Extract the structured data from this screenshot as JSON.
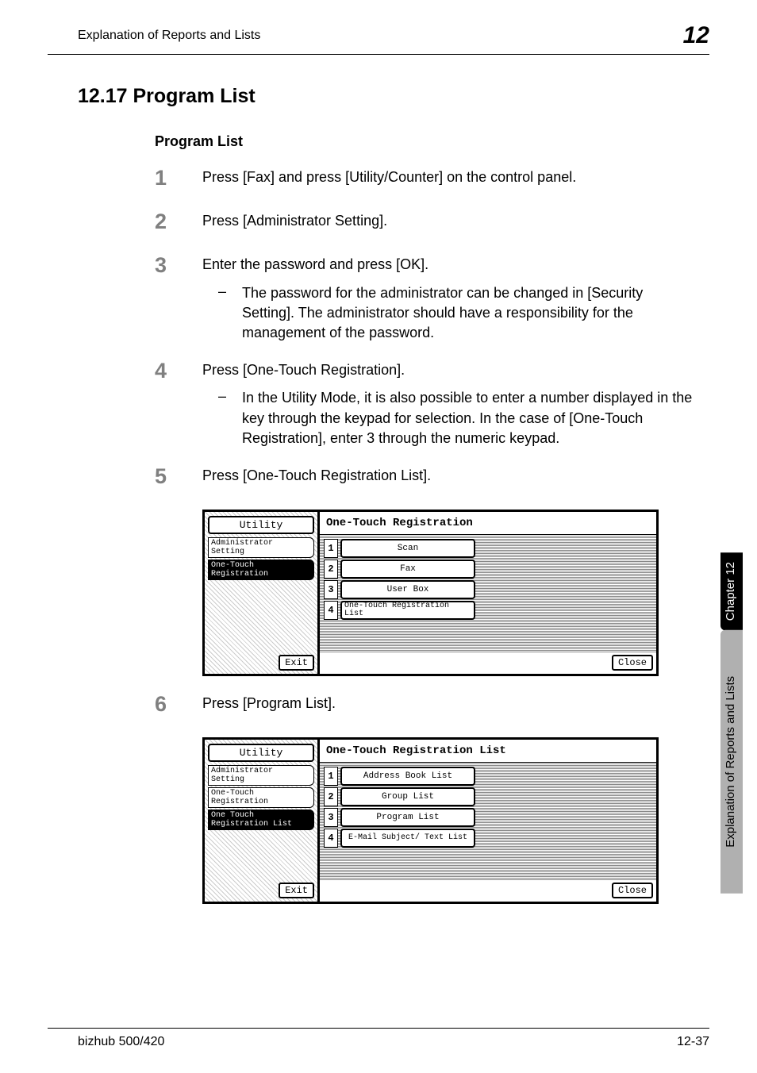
{
  "header": {
    "title": "Explanation of Reports and Lists",
    "number": "12"
  },
  "section": {
    "heading": "12.17  Program List",
    "subheading": "Program List"
  },
  "steps": {
    "s1": {
      "num": "1",
      "text": "Press [Fax] and press [Utility/Counter] on the control panel."
    },
    "s2": {
      "num": "2",
      "text": "Press [Administrator Setting]."
    },
    "s3": {
      "num": "3",
      "text": "Enter the password and press [OK].",
      "sub": "The password for the administrator can be changed in [Security Setting]. The administrator should have a responsibility for the management of the password."
    },
    "s4": {
      "num": "4",
      "text": "Press [One-Touch Registration].",
      "sub": "In the Utility Mode, it is also possible to enter a number displayed in the key through the keypad for selection. In the case of [One-Touch Registration], enter 3 through the numeric keypad."
    },
    "s5": {
      "num": "5",
      "text": "Press [One-Touch Registration List]."
    },
    "s6": {
      "num": "6",
      "text": "Press [Program List]."
    }
  },
  "screenshot1": {
    "leftTitle": "Utility",
    "crumb1": "Administrator Setting",
    "crumb2": "One-Touch Registration",
    "exit": "Exit",
    "rightTitle": "One-Touch Registration",
    "item1num": "1",
    "item1": "Scan",
    "item2num": "2",
    "item2": "Fax",
    "item3num": "3",
    "item3": "User Box",
    "item4num": "4",
    "item4": "One-Touch Registration List",
    "close": "Close"
  },
  "screenshot2": {
    "leftTitle": "Utility",
    "crumb1": "Administrator Setting",
    "crumb2": "One-Touch Registration",
    "crumb3": "One Touch Registration List",
    "exit": "Exit",
    "rightTitle": "One-Touch Registration List",
    "item1num": "1",
    "item1": "Address Book List",
    "item2num": "2",
    "item2": "Group List",
    "item3num": "3",
    "item3": "Program List",
    "item4num": "4",
    "item4": "E-Mail Subject/ Text List",
    "close": "Close"
  },
  "tab": {
    "black": "Chapter 12",
    "gray": "Explanation of Reports and Lists"
  },
  "footer": {
    "left": "bizhub 500/420",
    "right": "12-37"
  },
  "dash": "–"
}
